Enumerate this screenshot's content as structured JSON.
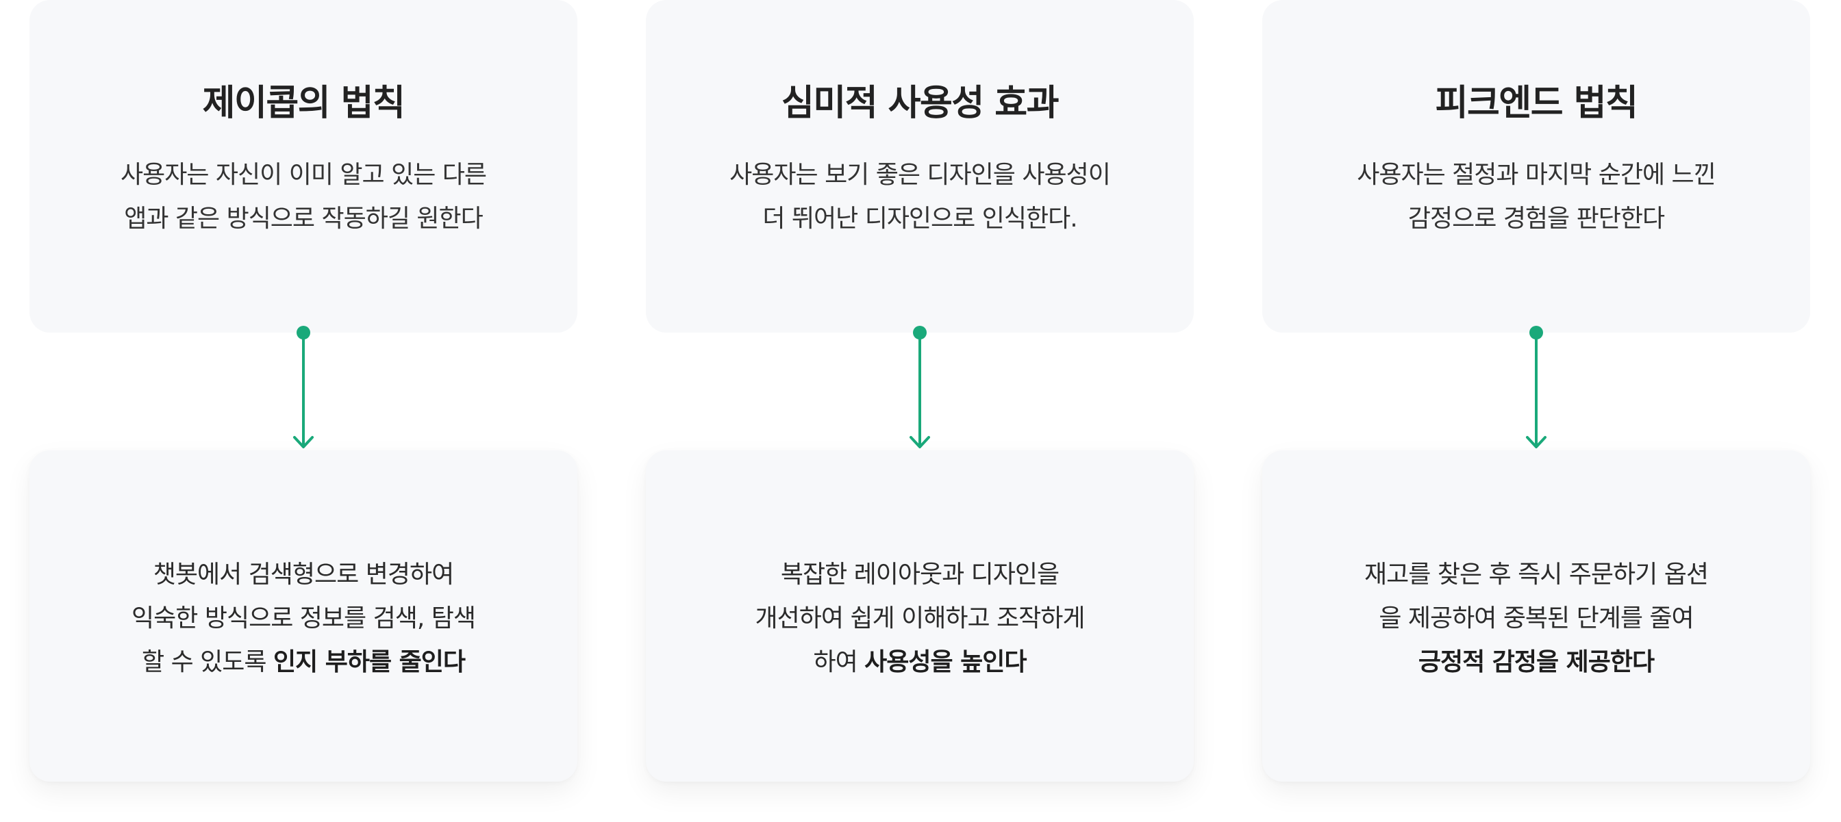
{
  "accent_color": "#1aa97a",
  "columns": [
    {
      "title": "제이콥의 법칙",
      "description": [
        "사용자는 자신이 이미 알고 있는 다른",
        "앱과 같은 방식으로 작동하길 원한다"
      ],
      "solution": {
        "lines": [
          "챗봇에서 검색형으로 변경하여",
          "익숙한 방식으로 정보를 검색, 탐색"
        ],
        "last_line_prefix": "할 수 있도록 ",
        "emphasis": "인지 부하를 줄인다"
      }
    },
    {
      "title": "심미적 사용성 효과",
      "description": [
        "사용자는 보기 좋은 디자인을 사용성이",
        "더 뛰어난 디자인으로 인식한다."
      ],
      "solution": {
        "lines": [
          "복잡한 레이아웃과 디자인을",
          "개선하여 쉽게 이해하고 조작하게"
        ],
        "last_line_prefix": "하여 ",
        "emphasis": "사용성을 높인다"
      }
    },
    {
      "title": "피크엔드 법칙",
      "description": [
        "사용자는 절정과 마지막 순간에 느낀",
        "감정으로 경험을 판단한다"
      ],
      "solution": {
        "lines": [
          "재고를 찾은 후 즉시 주문하기 옵션",
          "을 제공하여 중복된 단계를 줄여"
        ],
        "last_line_prefix": "",
        "emphasis": "긍정적 감정을 제공한다"
      }
    }
  ]
}
